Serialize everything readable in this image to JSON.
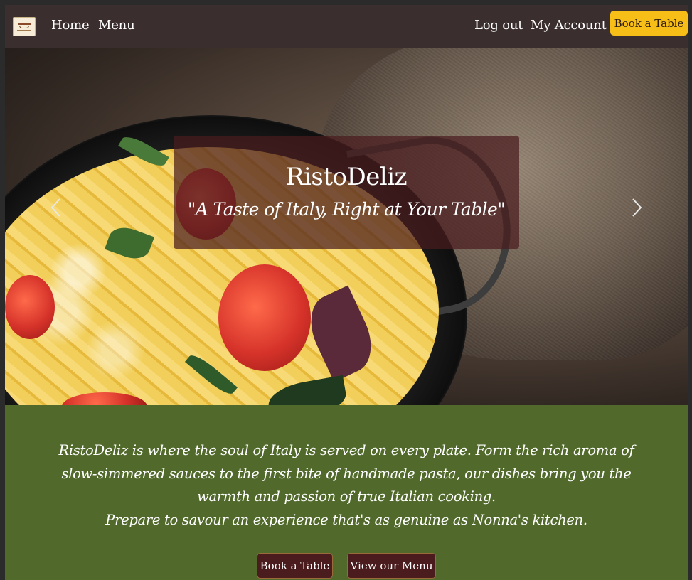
{
  "navbar": {
    "home_label": "Home",
    "menu_label": "Menu",
    "logout_label": "Log out",
    "account_label": "My Account",
    "book_label": "Book a Table"
  },
  "hero": {
    "title": "RistoDeliz",
    "subtitle": "\"A Taste of Italy, Right at Your Table\"",
    "prev_icon": "chevron-left-icon",
    "next_icon": "chevron-right-icon"
  },
  "about": {
    "lines": [
      "RistoDeliz is where the soul of Italy is served on every plate. Form the rich aroma of",
      "slow-simmered sauces to the first bite of handmade pasta, our dishes bring you the",
      "warmth and passion of true Italian cooking.",
      "Prepare to savour an experience that's as genuine as Nonna's kitchen."
    ],
    "book_label": "Book a Table",
    "menu_label": "View our Menu"
  },
  "colors": {
    "navbar_bg": "#3b2e2e",
    "accent_yellow": "#f7be18",
    "about_bg": "#516a2c",
    "button_dark": "#4a1c1e",
    "caption_bg": "#4a1c1e"
  }
}
